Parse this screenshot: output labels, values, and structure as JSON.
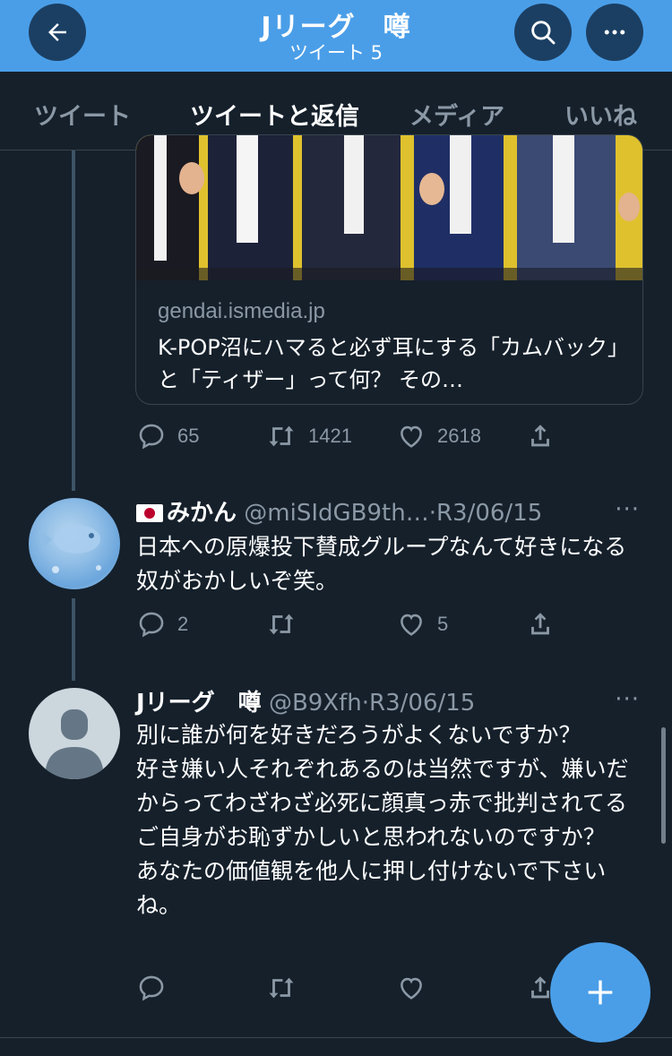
{
  "header": {
    "title": "Jリーグ　噂",
    "subtitle": "ツイート 5",
    "back_icon": "arrow-left-icon",
    "search_icon": "search-icon",
    "more_icon": "more-horizontal-icon",
    "accent_color": "#4a9ee8"
  },
  "tabs": [
    {
      "label": "ツイート",
      "active": false
    },
    {
      "label": "ツイートと返信",
      "active": true
    },
    {
      "label": "メディア",
      "active": false
    },
    {
      "label": "いいね",
      "active": false
    }
  ],
  "card": {
    "domain": "gendai.ismedia.jp",
    "title": "K-POP沼にハマると必ず耳にする「カムバック」と「ティザー」って何？ その…"
  },
  "tweet1_actions": {
    "replies": "65",
    "retweets": "1421",
    "likes": "2618"
  },
  "tweet2": {
    "flag": "🇯🇵",
    "name": "みかん",
    "handle": "@miSIdGB9th…",
    "date": "·R3/06/15",
    "more": "···",
    "body": "日本への原爆投下賛成グループなんて好きになる奴がおかしいぞ笑。",
    "replies": "2",
    "retweets": "",
    "likes": "5"
  },
  "tweet3": {
    "name": "Jリーグ　噂",
    "handle": "@B9Xfh",
    "date": "·R3/06/15",
    "more": "···",
    "body": "別に誰が何を好きだろうがよくないですか？\n好き嫌い人それぞれあるのは当然ですが、嫌いだからってわざわざ必死に顔真っ赤で批判されてるご自身がお恥ずかしいと思われないのですか？\nあなたの価値観を他人に押し付けないで下さいね。"
  },
  "fab": {
    "icon": "plus-icon"
  }
}
